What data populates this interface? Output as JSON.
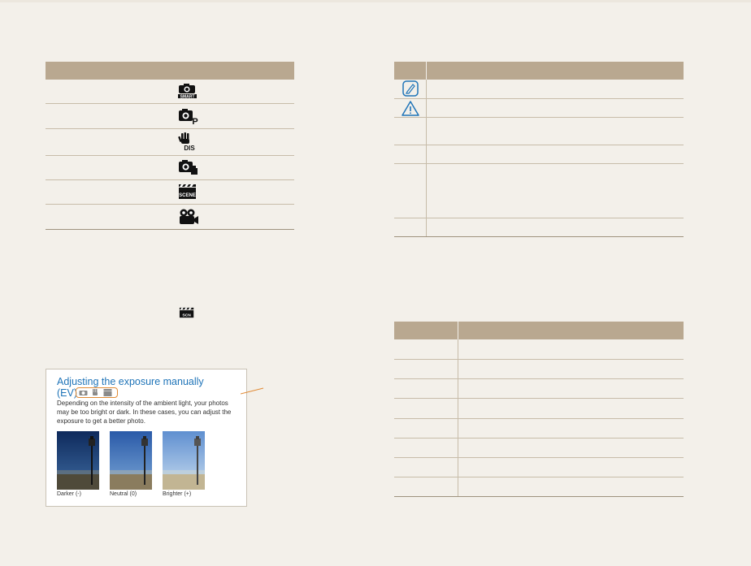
{
  "callout": {
    "title": "Adjusting the exposure manually",
    "ev_label": "(EV)",
    "mode_icons": [
      "smart-auto-icon",
      "dual-is-icon",
      "scene-icon"
    ],
    "body": "Depending on the intensity of the ambient light, your photos may be too bright or dark. In these cases, you can adjust the exposure to get a better photo.",
    "photos": [
      {
        "caption": "Darker (-)",
        "tone": "dark"
      },
      {
        "caption": "Neutral (0)",
        "tone": "neutral"
      },
      {
        "caption": "Brighter (+)",
        "tone": "bright"
      }
    ]
  },
  "tables": {
    "mode_icons": {
      "rows": [
        "smart-auto-icon",
        "program-icon",
        "dual-is-icon",
        "smart-scene-icon",
        "scene-icon",
        "movie-icon"
      ]
    },
    "notice_icons": {
      "rows": [
        "note-icon",
        "caution-icon",
        "",
        "",
        "",
        ""
      ]
    },
    "list_table_rows": 8
  },
  "inline_icon": "scene-icon",
  "colors": {
    "header": "#b9a890",
    "background": "#f3f0ea",
    "title_blue": "#1f74b8",
    "highlight_orange": "#e08a35"
  }
}
